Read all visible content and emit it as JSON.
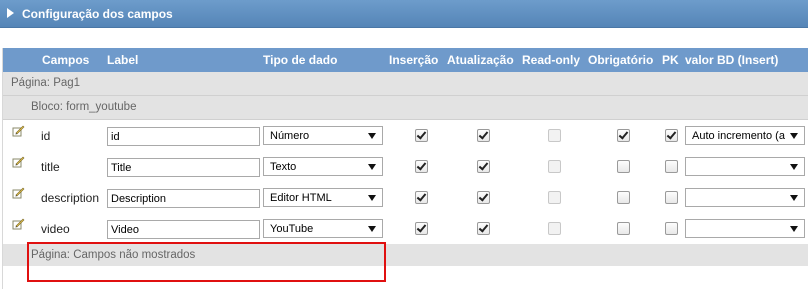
{
  "header": {
    "title": "Configuração dos campos"
  },
  "columns": [
    "Campos",
    "Label",
    "Tipo de dado",
    "Inserção",
    "Atualização",
    "Read-only",
    "Obrigatório",
    "PK",
    "valor BD (Insert)"
  ],
  "groups": {
    "page": "Página: Pag1",
    "block": "Bloco: form_youtube",
    "hidden_page": "Página: Campos não mostrados"
  },
  "rows": [
    {
      "field": "id",
      "label": "id",
      "type": "Número",
      "insert": true,
      "update": true,
      "readonly": false,
      "required": true,
      "pk": true,
      "db_value": "Auto incremento (a"
    },
    {
      "field": "title",
      "label": "Title",
      "type": "Texto",
      "insert": true,
      "update": true,
      "readonly": false,
      "required": false,
      "pk": false,
      "db_value": ""
    },
    {
      "field": "description",
      "label": "Description",
      "type": "Editor HTML",
      "insert": true,
      "update": true,
      "readonly": false,
      "required": false,
      "pk": false,
      "db_value": ""
    },
    {
      "field": "video",
      "label": "Video",
      "type": "YouTube",
      "insert": true,
      "update": true,
      "readonly": false,
      "required": false,
      "pk": false,
      "db_value": ""
    }
  ],
  "colors": {
    "header_bg": "#6f9acb",
    "highlight": "#e01010"
  }
}
